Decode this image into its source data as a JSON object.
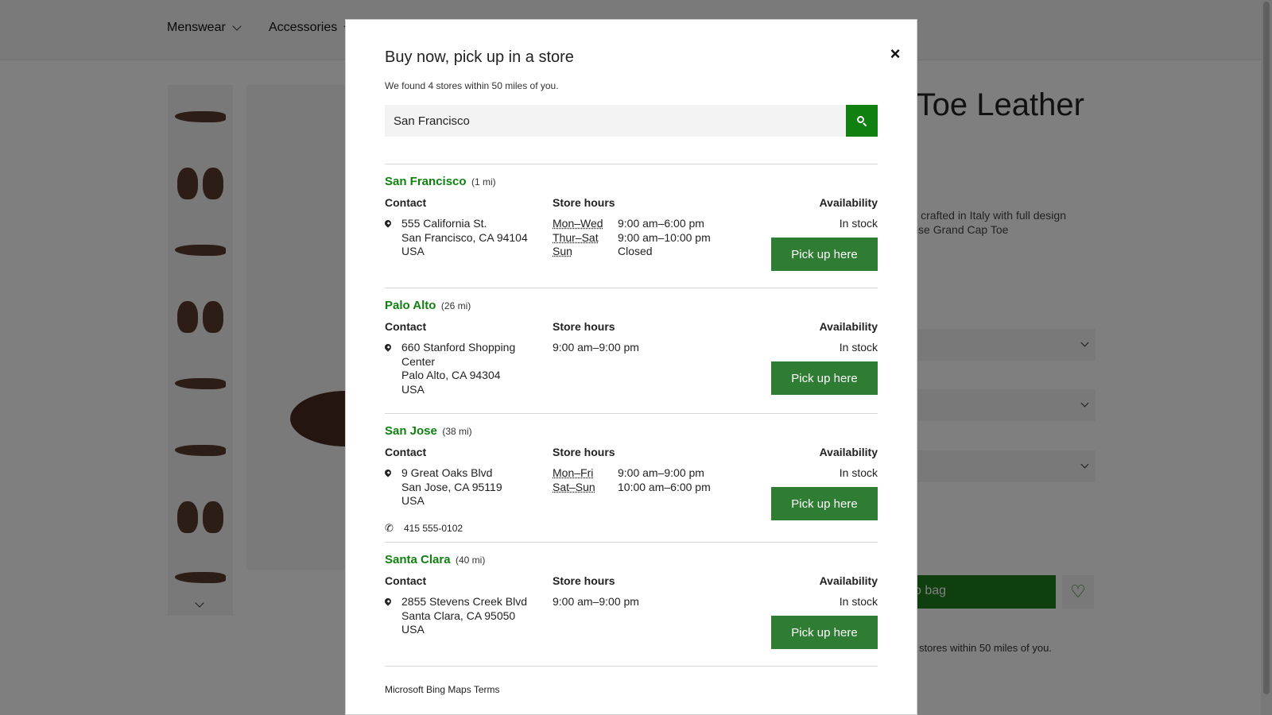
{
  "background": {
    "nav": {
      "menswear": "Menswear",
      "accessories": "Accessories"
    },
    "product_title_fragment": "p Toe Leather",
    "description_fragment": "pertly crafted in Italy with full design of these Grand Cap Toe",
    "add_to_bag_fragment": "o bag",
    "stores_note_fragment": "stores within 50 miles of you."
  },
  "modal": {
    "title": "Buy now, pick up in a store",
    "close_icon": "×",
    "subtitle": "We found 4 stores within 50 miles of you.",
    "search": {
      "value": "San Francisco",
      "icon": "search-icon"
    },
    "column_labels": {
      "contact": "Contact",
      "hours": "Store hours",
      "availability": "Availability"
    },
    "pick_label": "Pick up here",
    "stores": [
      {
        "name": "San Francisco",
        "distance": "(1 mi)",
        "address": [
          "555 California St.",
          "San Francisco, CA 94104",
          "USA"
        ],
        "hours": [
          {
            "days": "Mon–Wed",
            "time": "9:00 am–6:00 pm"
          },
          {
            "days": "Thur–Sat",
            "time": "9:00 am–10:00 pm"
          },
          {
            "days": "Sun",
            "time": "Closed"
          }
        ],
        "availability": "In stock"
      },
      {
        "name": "Palo Alto",
        "distance": "(26 mi)",
        "address": [
          "660 Stanford Shopping",
          "Center",
          "Palo Alto, CA 94304",
          "USA"
        ],
        "hours_single": "9:00 am–9:00 pm",
        "availability": "In stock"
      },
      {
        "name": "San Jose",
        "distance": "(38 mi)",
        "address": [
          "9 Great Oaks Blvd",
          "San Jose, CA 95119",
          "USA"
        ],
        "phone": "415 555-0102",
        "hours": [
          {
            "days": "Mon–Fri",
            "time": "9:00 am–9:00 pm"
          },
          {
            "days": "Sat–Sun",
            "time": "10:00 am–6:00 pm"
          }
        ],
        "availability": "In stock"
      },
      {
        "name": "Santa Clara",
        "distance": "(40 mi)",
        "address": [
          "2855 Stevens Creek Blvd",
          "Santa Clara, CA 95050",
          "USA"
        ],
        "hours_single": "9:00 am–9:00 pm",
        "availability": "In stock"
      }
    ],
    "footer": "Microsoft Bing Maps Terms"
  },
  "colors": {
    "accent_green": "#108010",
    "button_green": "#2e7d32",
    "overlay": "rgba(0,0,0,0.5)"
  }
}
